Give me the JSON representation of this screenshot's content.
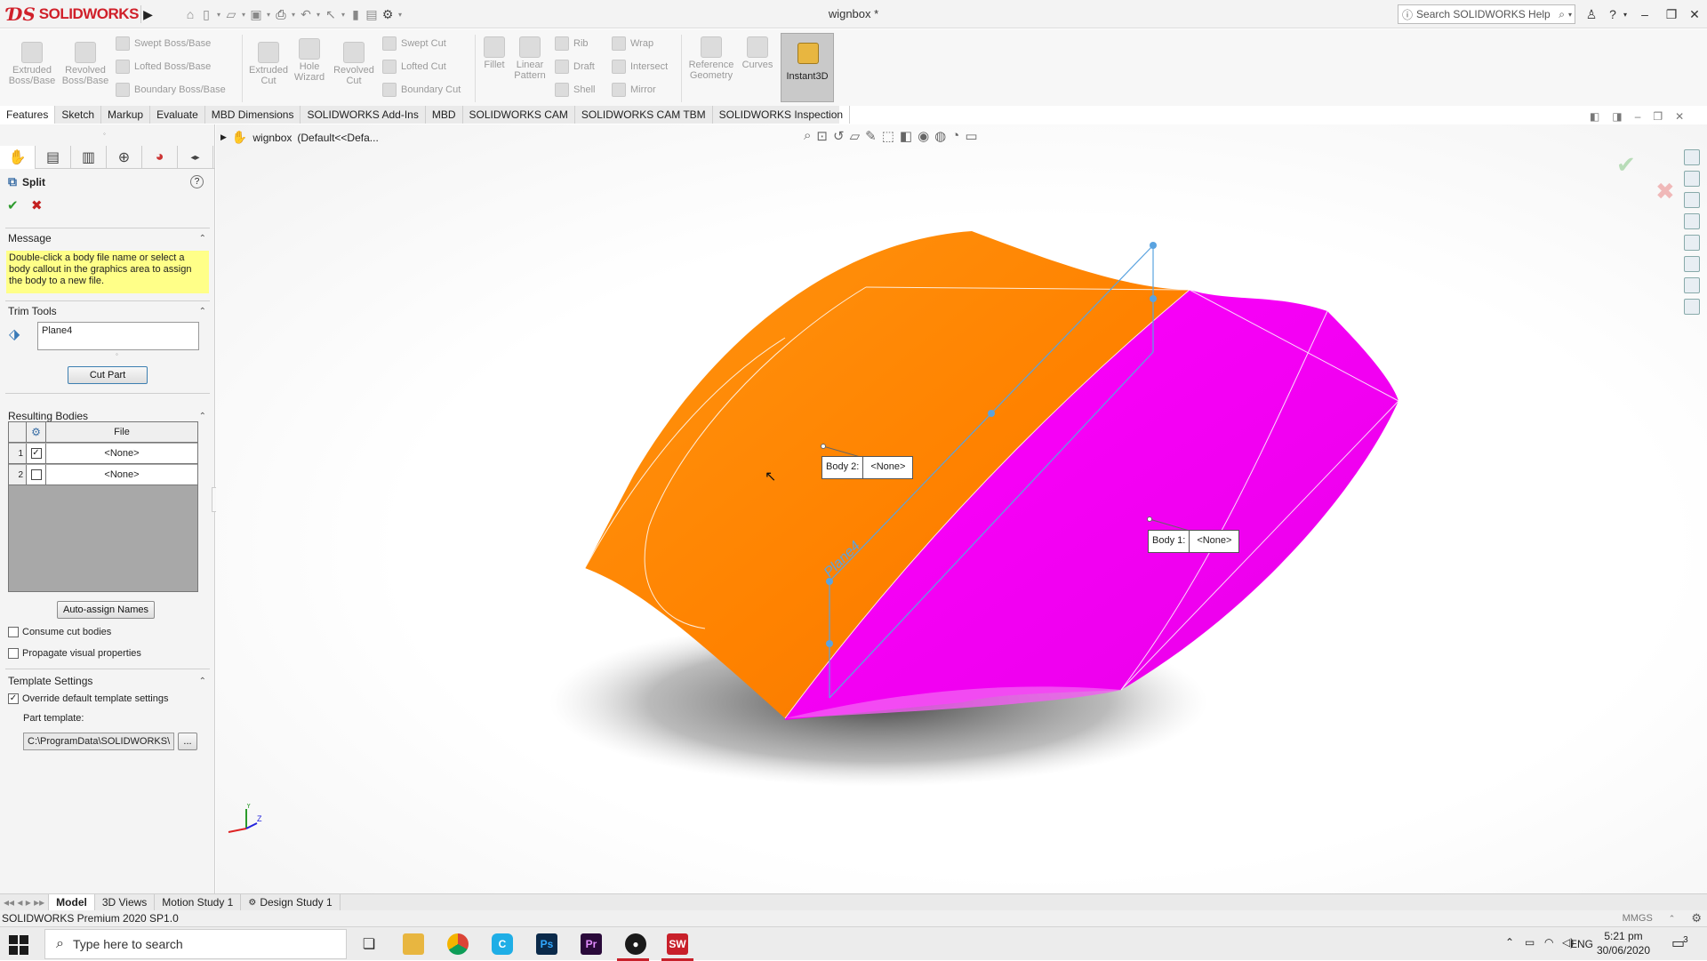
{
  "app": {
    "logo_text": "SOLIDWORKS",
    "document_title": "wignbox *",
    "search_placeholder": "Search SOLIDWORKS Help"
  },
  "ribbon": {
    "extruded_boss": "Extruded Boss/Base",
    "revolved_boss": "Revolved Boss/Base",
    "swept_boss": "Swept Boss/Base",
    "lofted_boss": "Lofted Boss/Base",
    "boundary_boss": "Boundary Boss/Base",
    "extruded_cut": "Extruded Cut",
    "hole_wizard": "Hole Wizard",
    "revolved_cut": "Revolved Cut",
    "swept_cut": "Swept Cut",
    "lofted_cut": "Lofted Cut",
    "boundary_cut": "Boundary Cut",
    "fillet": "Fillet",
    "linear_pattern": "Linear Pattern",
    "rib": "Rib",
    "draft": "Draft",
    "shell": "Shell",
    "wrap": "Wrap",
    "intersect": "Intersect",
    "mirror": "Mirror",
    "reference_geometry": "Reference Geometry",
    "curves": "Curves",
    "instant3d": "Instant3D"
  },
  "tabs": [
    "Features",
    "Sketch",
    "Markup",
    "Evaluate",
    "MBD Dimensions",
    "SOLIDWORKS Add-Ins",
    "MBD",
    "SOLIDWORKS CAM",
    "SOLIDWORKS CAM TBM",
    "SOLIDWORKS Inspection"
  ],
  "panel": {
    "title": "Split",
    "message_header": "Message",
    "message_text": "Double-click a body file name or select a body callout in the graphics area to assign the body to a new file.",
    "trim_tools_header": "Trim Tools",
    "trim_tool_value": "Plane4",
    "cut_part_label": "Cut Part",
    "resulting_bodies_header": "Resulting Bodies",
    "file_column": "File",
    "rows": [
      {
        "num": "1",
        "checked": true,
        "file": "<None>"
      },
      {
        "num": "2",
        "checked": false,
        "file": "<None>"
      }
    ],
    "auto_assign_label": "Auto-assign Names",
    "consume_label": "Consume cut bodies",
    "propagate_label": "Propagate visual properties",
    "template_header": "Template Settings",
    "override_label": "Override default template settings",
    "part_template_label": "Part template:",
    "part_template_value": "C:\\ProgramData\\SOLIDWORKS\\",
    "browse_label": "..."
  },
  "graphics": {
    "tree_root": "wignbox",
    "tree_config": "(Default<<Defa...",
    "callout_body2_label": "Body 2:",
    "callout_body2_value": "<None>",
    "callout_body1_label": "Body 1:",
    "callout_body1_value": "<None>",
    "plane_label": "Plane4",
    "body_colors": {
      "body2": "#ff8a00",
      "body1": "#ff00ff"
    }
  },
  "bottom_tabs": [
    "Model",
    "3D Views",
    "Motion Study 1",
    "Design Study 1"
  ],
  "status": {
    "left": "SOLIDWORKS Premium 2020 SP1.0",
    "units": "MMGS"
  },
  "taskbar": {
    "search_placeholder": "Type here to search",
    "language": "ENG",
    "time": "5:21 pm",
    "date": "30/06/2020",
    "notification_count": "3"
  }
}
